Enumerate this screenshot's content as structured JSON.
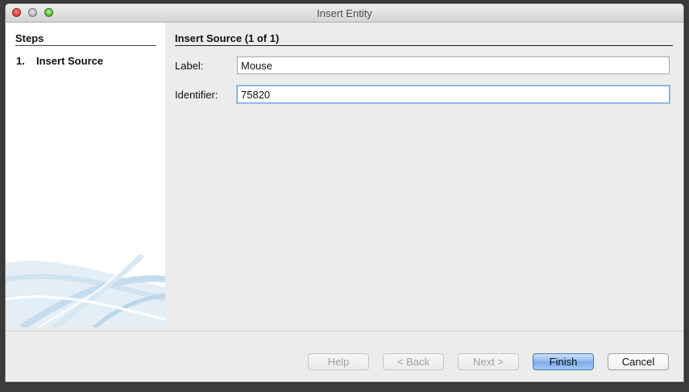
{
  "window": {
    "title": "Insert Entity"
  },
  "steps": {
    "heading": "Steps",
    "items": [
      {
        "number": "1.",
        "label": "Insert Source"
      }
    ]
  },
  "content": {
    "heading": "Insert Source (1 of 1)",
    "fields": [
      {
        "label": "Label:",
        "value": "Mouse"
      },
      {
        "label": "Identifier:",
        "value": "75820"
      }
    ]
  },
  "buttons": {
    "help": "Help",
    "back": "< Back",
    "next": "Next >",
    "finish": "Finish",
    "cancel": "Cancel"
  }
}
